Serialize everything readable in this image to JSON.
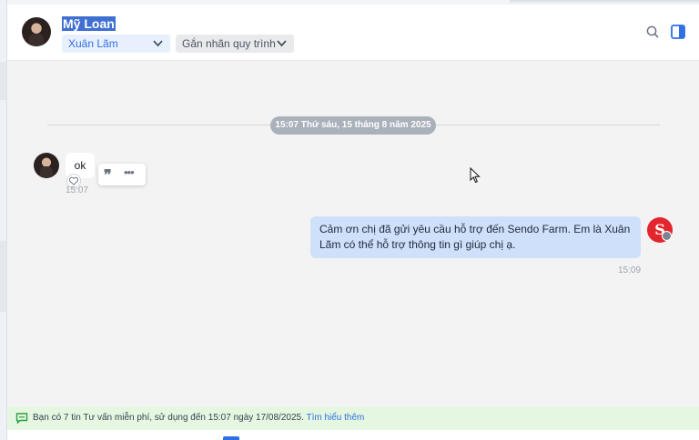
{
  "contact": {
    "name": "Mỹ Loan"
  },
  "header": {
    "assignee": "Xuân Lãm",
    "tag_button": "Gắn nhãn quy trình",
    "icons": [
      "search-icon",
      "panel-toggle-icon",
      "chevron-down-icon"
    ]
  },
  "chat": {
    "date_separator": "15:07 Thứ sáu, 15 tháng 8 năm 2025",
    "incoming": {
      "text": "ok",
      "time": "15:07",
      "tools": [
        "quote-icon",
        "more-icon",
        "heart-icon"
      ]
    },
    "outgoing": {
      "text": "Cảm ơn chị đã gửi yêu cầu hỗ trợ đến Sendo Farm. Em là Xuân Lãm có thể hỗ trợ thông tin gì giúp chị ạ.",
      "time": "15:09",
      "avatar_letter": "S"
    }
  },
  "notice": {
    "text": "Bạn có 7 tin Tư vấn miễn phí, sử dụng đến 15:07 ngày 17/08/2025.",
    "link": "Tìm hiểu thêm",
    "icon": "chat-bubble-icon"
  },
  "colors": {
    "accent": "#2f6fe4",
    "chat_bg": "#f3f3f3",
    "outgoing_bubble": "#cfe0fb",
    "notice_bg": "#e5f7e0",
    "brand_red": "#e3262d"
  }
}
